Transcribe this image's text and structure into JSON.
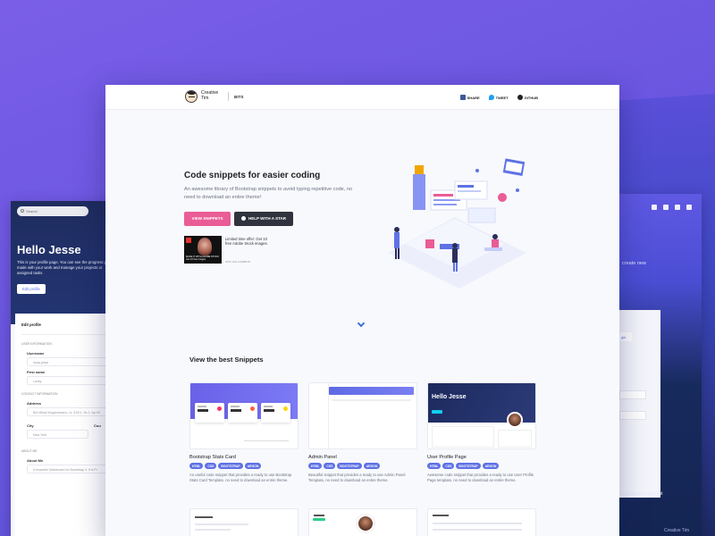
{
  "left_card": {
    "search_placeholder": "Search",
    "title": "Hello Jesse",
    "description": "This is your profile page. You can see the progress you've made with your work and manage your projects or assigned tasks",
    "button": "Edit profile",
    "panel_title": "Edit profile",
    "section_user": "User information",
    "username_label": "Username",
    "username_value": "lucky.jesse",
    "firstname_label": "First name",
    "firstname_value": "Lucky",
    "section_contact": "Contact information",
    "address_label": "Address",
    "address_value": "Bld Mihail Kogalniceanu, nr. 8 Bl 1, Sc 1, Ap 09",
    "city_label": "City",
    "city_value": "New York",
    "country_label": "Cou",
    "section_about": "About me",
    "about_label": "About Me",
    "about_value": "A beautiful Dashboard for Bootstrap 4. It is Fr"
  },
  "right_card": {
    "text": "create new",
    "button": "gle",
    "create_account": "Create new account",
    "brand": "Creative Tim"
  },
  "topbar": {
    "brand_name": "Creative Tim",
    "brand_section": "BITS",
    "share": "SHARE",
    "tweet": "TWEET",
    "github": "GITHUB"
  },
  "hero": {
    "title": "Code snippets for easier coding",
    "description": "An awesome library of Bootstrap snippets to avoid typing repetitive code, no need to download an entire theme!",
    "btn_view": "VIEW SNIPPETS",
    "btn_star": "HELP WITH A STAR",
    "ad_caption": "MAKE IT WITH ADOBE STOCK Get 10 free images",
    "ad_text": "Limited time offer: Get 10 free Adobe Stock images.",
    "ad_by": "ADS VIA CARBON"
  },
  "snippets_title": "View the best Snippets",
  "snippets": [
    {
      "title": "Bootstrap Stats Card",
      "tags": [
        "HTML",
        "CSS",
        "BOOTSTRAP",
        "ARGON"
      ],
      "description": "An useful code snippet that provides a ready to use Bootstrap Stats Card Template, no need to download an entire theme."
    },
    {
      "title": "Admin Panel",
      "tags": [
        "HTML",
        "CSS",
        "BOOTSTRAP",
        "ARGON"
      ],
      "description": "Beautiful snippet that provides a ready to use Admin Panel Template, no need to download an entire theme."
    },
    {
      "title": "User Profile Page",
      "tags": [
        "HTML",
        "CSS",
        "BOOTSTRAP",
        "ARGON"
      ],
      "description": "Awesome code snippet that provides a ready to use User Profile Page template, no need to download an entire theme."
    }
  ],
  "thumb_texts": {
    "t3_hero": "Hello Jesse"
  },
  "colors": {
    "accent_pink": "#ea5c95",
    "dark_button": "#30323d",
    "tag_blue": "#5e72e4"
  }
}
